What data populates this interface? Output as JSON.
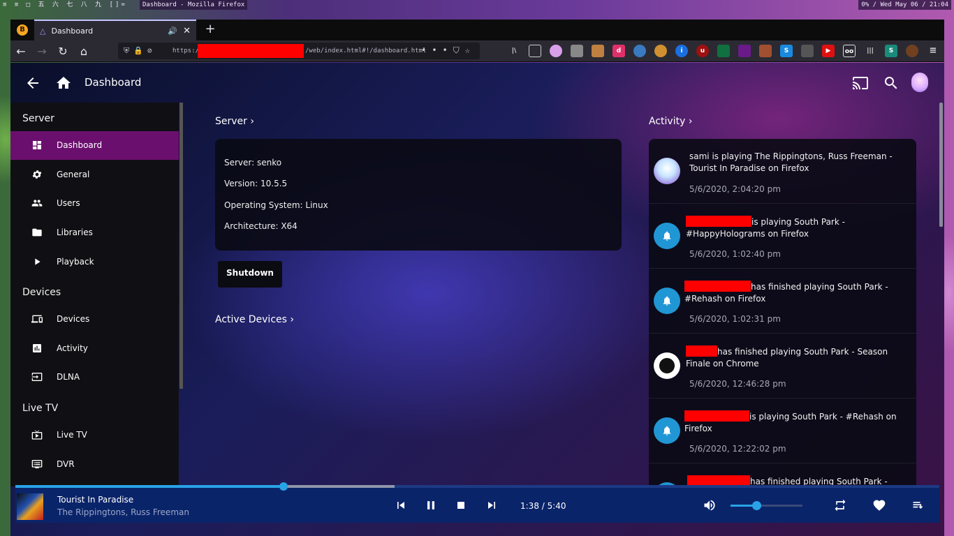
{
  "wm": {
    "workspaces": "≡ ≡ □ 五 六 七 八 九 []=",
    "window_title": "Dashboard - Mozilla Firefox",
    "tray": "0% / Wed May 06 / 21:04"
  },
  "browser": {
    "tab_title": "Dashboard",
    "new_tab": "+",
    "url_scheme": "https://",
    "url_path": "/web/index.html#!/dashboard.html"
  },
  "app": {
    "page_title": "Dashboard"
  },
  "sidebar": {
    "sections": [
      {
        "title": "Server",
        "items": [
          {
            "label": "Dashboard",
            "icon": "dashboard-icon",
            "active": true
          },
          {
            "label": "General",
            "icon": "gear-icon"
          },
          {
            "label": "Users",
            "icon": "users-icon"
          },
          {
            "label": "Libraries",
            "icon": "folder-icon"
          },
          {
            "label": "Playback",
            "icon": "play-icon"
          }
        ]
      },
      {
        "title": "Devices",
        "items": [
          {
            "label": "Devices",
            "icon": "devices-icon"
          },
          {
            "label": "Activity",
            "icon": "bar-chart-icon"
          },
          {
            "label": "DLNA",
            "icon": "input-icon"
          }
        ]
      },
      {
        "title": "Live TV",
        "items": [
          {
            "label": "Live TV",
            "icon": "tv-icon"
          },
          {
            "label": "DVR",
            "icon": "dvr-icon"
          }
        ]
      }
    ]
  },
  "server_section": {
    "title": "Server",
    "server_line": "Server: senko",
    "version_line": "Version: 10.5.5",
    "os_line": "Operating System: Linux",
    "arch_line": "Architecture: X64",
    "shutdown_label": "Shutdown"
  },
  "active_devices": {
    "title": "Active Devices"
  },
  "activity": {
    "title": "Activity",
    "items": [
      {
        "text": "sami is playing The Rippingtons, Russ Freeman - Tourist In Paradise on Firefox",
        "date": "5/6/2020, 2:04:20 pm"
      },
      {
        "text": "is playing South Park - #HappyHolograms on Firefox",
        "date": "5/6/2020, 1:02:40 pm"
      },
      {
        "text": "has finished playing South Park - #Rehash on Firefox",
        "date": "5/6/2020, 1:02:31 pm"
      },
      {
        "text": "has finished playing South Park - Season Finale on Chrome",
        "date": "5/6/2020, 12:46:28 pm"
      },
      {
        "text": "is playing South Park - #Rehash on Firefox",
        "date": "5/6/2020, 12:22:02 pm"
      },
      {
        "text": "has finished playing South Park -",
        "date": ""
      }
    ]
  },
  "now_playing": {
    "title": "Tourist In Paradise",
    "artist": "The Rippingtons, Russ Freeman",
    "time": "1:38 / 5:40",
    "progress": 0.29,
    "volume": 0.36
  },
  "colors": {
    "accent": "#29a3e6",
    "sidebar_active": "#6b0f6f",
    "activity_icon": "#2196d4",
    "now_playing_bg": "#0a246a"
  }
}
